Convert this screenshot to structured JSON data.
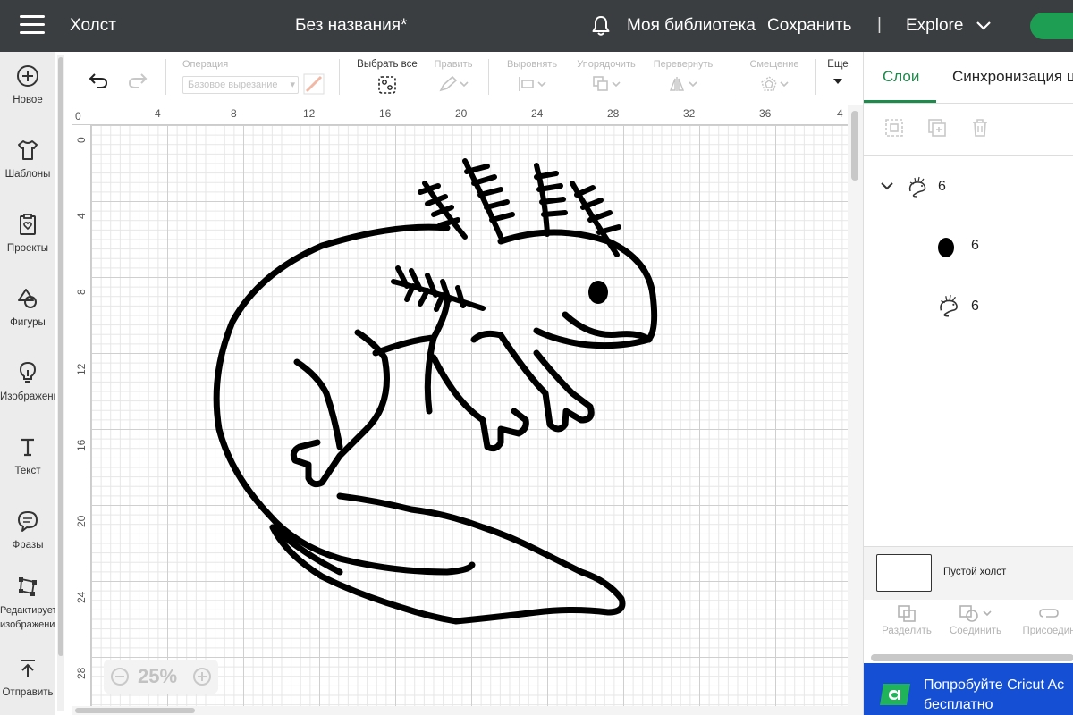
{
  "header": {
    "menu_icon": "hamburger-icon",
    "title": "Холст",
    "project_name": "Без названия*",
    "notifications_icon": "bell-icon",
    "library_label": "Моя библиотека",
    "save_label": "Сохранить",
    "separator": "|",
    "explore_label": "Explore",
    "accent_color": "#1e9e52"
  },
  "sidebar": {
    "items": [
      {
        "label": "Новое",
        "icon": "plus-circle-icon"
      },
      {
        "label": "Шаблоны",
        "icon": "tshirt-icon"
      },
      {
        "label": "Проекты",
        "icon": "clipboard-heart-icon"
      },
      {
        "label": "Фигуры",
        "icon": "shapes-icon"
      },
      {
        "label": "Изображения",
        "icon": "lightbulb-icon"
      },
      {
        "label": "Текст",
        "icon": "text-t-icon"
      },
      {
        "label": "Фразы",
        "icon": "speech-bubble-icon"
      },
      {
        "label": "Редактирует изображения",
        "icon": "edit-image-icon"
      },
      {
        "label": "Отправить",
        "icon": "upload-icon"
      }
    ]
  },
  "toolbar": {
    "undo_icon": "undo-icon",
    "redo_icon": "redo-icon",
    "operation_label": "Операция",
    "operation_value": "Базовое вырезание",
    "select_all_label": "Выбрать все",
    "edit_label": "Править",
    "align_label": "Выровнять",
    "arrange_label": "Упорядочить",
    "flip_label": "Перевернуть",
    "offset_label": "Смещение",
    "more_label": "Еще"
  },
  "canvas": {
    "ruler_top_ticks": [
      "0",
      "4",
      "8",
      "12",
      "16",
      "20",
      "24",
      "28",
      "32",
      "36",
      "4"
    ],
    "ruler_left_ticks": [
      "0",
      "4",
      "8",
      "12",
      "16",
      "20",
      "24",
      "28"
    ],
    "zoom_value": "25%",
    "drawing": "axolotl-outline"
  },
  "right_panel": {
    "tab_layers": "Слои",
    "tab_sync": "Синхронизация цв",
    "icons": [
      "group-icon",
      "duplicate-icon",
      "trash-icon"
    ],
    "layers": [
      {
        "name": "6",
        "icon": "axolotl-thumbnail-icon",
        "level": 0,
        "expanded": true
      },
      {
        "name": "6",
        "icon": "black-ellipse-icon",
        "level": 1
      },
      {
        "name": "6",
        "icon": "axolotl-thumbnail-icon",
        "level": 1
      }
    ],
    "blank_canvas_label": "Пустой холст",
    "actions": [
      {
        "label": "Разделить",
        "icon": "slice-icon"
      },
      {
        "label": "Соединить",
        "icon": "combine-icon"
      },
      {
        "label": "Присоедин",
        "icon": "attach-icon"
      }
    ],
    "promo_text_line1": "Попробуйте Cricut Ac",
    "promo_text_line2": "бесплатно",
    "promo_color": "#1550d4"
  }
}
